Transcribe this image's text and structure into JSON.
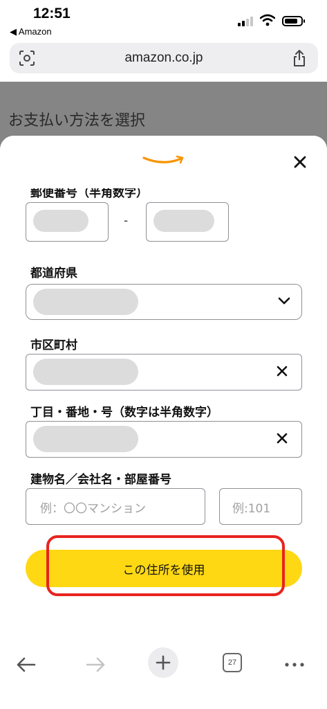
{
  "status_bar": {
    "time": "12:51",
    "back_app": "◀ Amazon"
  },
  "browser": {
    "url": "amazon.co.jp",
    "tab_count": "27"
  },
  "page": {
    "title": "お支払い方法を選択"
  },
  "form": {
    "postal_label": "郵便番号（半角数字）",
    "postal_separator": "-",
    "prefecture_label": "都道府県",
    "city_label": "市区町村",
    "street_label": "丁目・番地・号（数字は半角数字）",
    "building_label": "建物名／会社名・部屋番号",
    "building_placeholder": "例：〇〇マンション",
    "room_placeholder": "例:101",
    "submit_label": "この住所を使用"
  },
  "colors": {
    "accent_button": "#ffd814",
    "highlight": "#e8231f",
    "amazon_orange": "#f79400"
  },
  "icons": [
    "scan-icon",
    "share-icon",
    "amazon-smile-logo",
    "close-icon",
    "chevron-down-icon",
    "clear-icon",
    "back-arrow-icon",
    "forward-arrow-icon",
    "plus-icon",
    "tabs-icon",
    "more-icon"
  ]
}
